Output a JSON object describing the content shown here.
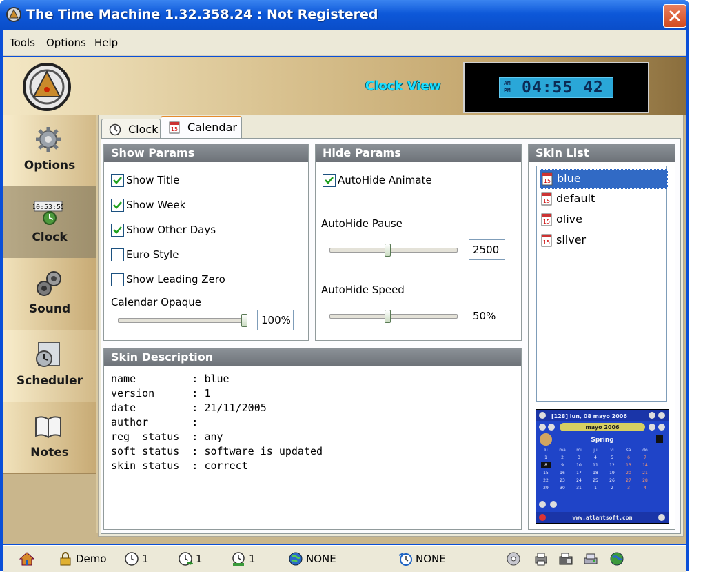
{
  "window": {
    "title": "The Time Machine 1.32.358.24 :  Not Registered"
  },
  "menu": [
    "Tools",
    "Options",
    "Help"
  ],
  "header": {
    "clock_view_label": "Clock View",
    "lcd_am": "AM",
    "lcd_pm": "PM",
    "lcd_time": "04:55 42"
  },
  "sidebar": [
    {
      "label": "Options",
      "icon": "gear-icon",
      "active": false
    },
    {
      "label": "Clock",
      "icon": "clock-icon",
      "active": true
    },
    {
      "label": "Sound",
      "icon": "speaker-icon",
      "active": false
    },
    {
      "label": "Scheduler",
      "icon": "scheduler-icon",
      "active": false
    },
    {
      "label": "Notes",
      "icon": "notes-icon",
      "active": false
    }
  ],
  "tabs": [
    {
      "label": "Clock",
      "active": false
    },
    {
      "label": "Calendar",
      "active": true
    }
  ],
  "show_params": {
    "title": "Show Params",
    "checkboxes": [
      {
        "label": "Show Title",
        "checked": true
      },
      {
        "label": "Show Week",
        "checked": true
      },
      {
        "label": "Show Other Days",
        "checked": true
      },
      {
        "label": "Euro Style",
        "checked": false
      },
      {
        "label": "Show Leading Zero",
        "checked": false
      }
    ],
    "opaque_label": "Calendar Opaque",
    "opaque_value": "100%",
    "opaque_level": 1.0
  },
  "hide_params": {
    "title": "Hide Params",
    "animate": {
      "label": "AutoHide Animate",
      "checked": true
    },
    "pause_label": "AutoHide Pause",
    "pause_value": "2500",
    "pause_level": 0.45,
    "speed_label": "AutoHide Speed",
    "speed_value": "50%",
    "speed_level": 0.45
  },
  "skin_list": {
    "title": "Skin List",
    "items": [
      "blue",
      "default",
      "olive",
      "silver"
    ],
    "selected": "blue"
  },
  "skin_description": {
    "title": "Skin Description",
    "rows": [
      "name         : blue",
      "version      : 1",
      "date         : 21/11/2005",
      "author       :",
      "reg  status  : any",
      "soft status  : software is updated",
      "skin status  : correct"
    ]
  },
  "preview": {
    "header": "[128] lun, 08 mayo 2006",
    "month": "mayo 2006",
    "season": "Spring",
    "weekdays": [
      "lu",
      "ma",
      "mi",
      "ju",
      "vi",
      "sa",
      "do"
    ],
    "weeks": [
      [
        "1",
        "2",
        "3",
        "4",
        "5",
        "6",
        "7"
      ],
      [
        "8",
        "9",
        "10",
        "11",
        "12",
        "13",
        "14"
      ],
      [
        "15",
        "16",
        "17",
        "18",
        "19",
        "20",
        "21"
      ],
      [
        "22",
        "23",
        "24",
        "25",
        "26",
        "27",
        "28"
      ],
      [
        "29",
        "30",
        "31",
        "1",
        "2",
        "3",
        "4"
      ]
    ],
    "footer": "www.atlantsoft.com"
  },
  "statusbar": [
    {
      "icon": "home-icon",
      "text": ""
    },
    {
      "icon": "lock-icon",
      "text": "Demo"
    },
    {
      "icon": "clock-icon",
      "text": "1"
    },
    {
      "icon": "clock-arrow-icon",
      "text": "1"
    },
    {
      "icon": "clock-user-icon",
      "text": "1"
    },
    {
      "icon": "globe-icon",
      "text": "NONE"
    },
    {
      "icon": "alarm-icon",
      "text": "NONE"
    },
    {
      "icon": "cd-icon",
      "text": ""
    },
    {
      "icon": "printer-icon",
      "text": ""
    },
    {
      "icon": "fax-icon",
      "text": ""
    },
    {
      "icon": "scanner-icon",
      "text": ""
    },
    {
      "icon": "earth-icon",
      "text": ""
    }
  ],
  "colors": {
    "titlebar": "#0a4fd8",
    "accent_tab": "#e68b2c",
    "selection": "#316ac5",
    "lcd": "#2aa7d8"
  }
}
